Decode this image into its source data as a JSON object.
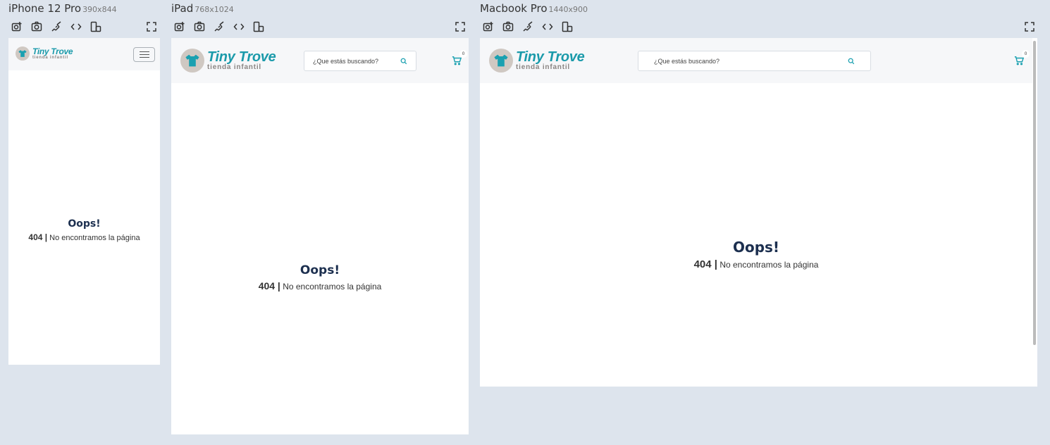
{
  "devices": [
    {
      "name": "iPhone 12 Pro",
      "size": "390x844"
    },
    {
      "name": "iPad",
      "size": "768x1024"
    },
    {
      "name": "Macbook Pro",
      "size": "1440x900"
    }
  ],
  "toolbar": {
    "icons": [
      "screenshot-icon",
      "camera-icon",
      "rotate-icon",
      "code-icon",
      "devices-icon"
    ],
    "expand_icon": "fullscreen-icon"
  },
  "site": {
    "logo_title": "Tiny Trove",
    "logo_subtitle": "tienda infantil",
    "search_placeholder": "¿Que estás buscando?",
    "cart_count": "0",
    "brand_color": "#1aa0b0",
    "heading_color": "#1c2f4f"
  },
  "error": {
    "title": "Oops!",
    "code": "404 |",
    "message": "No encontramos la página"
  }
}
